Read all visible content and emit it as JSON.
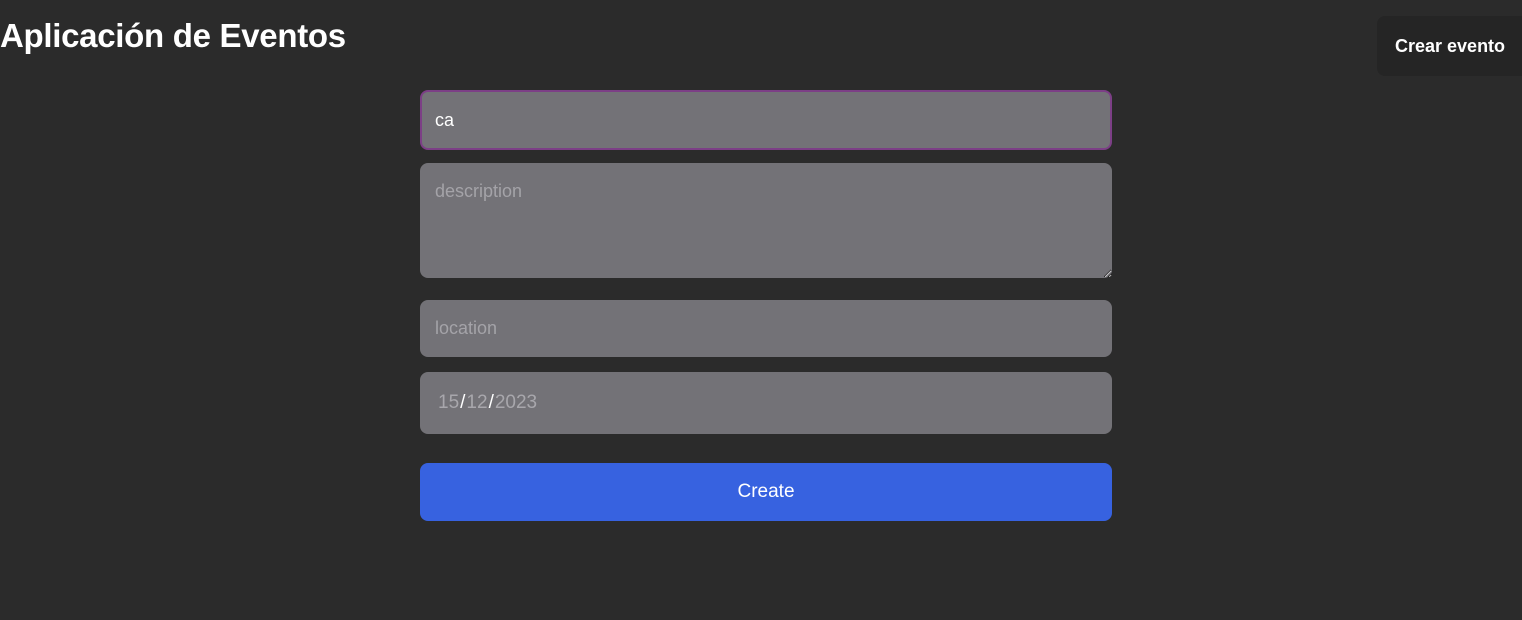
{
  "header": {
    "title": "Aplicación de Eventos",
    "nav_button_label": "Crear evento"
  },
  "form": {
    "title_value": "ca",
    "description_placeholder": "description",
    "location_placeholder": "location",
    "date": {
      "day": "15",
      "month": "12",
      "year": "2023",
      "separator": "/"
    },
    "submit_label": "Create"
  },
  "colors": {
    "background": "#2b2b2b",
    "field_background": "#737277",
    "focused_border": "#7c3f86",
    "primary_button": "#3762e0"
  }
}
